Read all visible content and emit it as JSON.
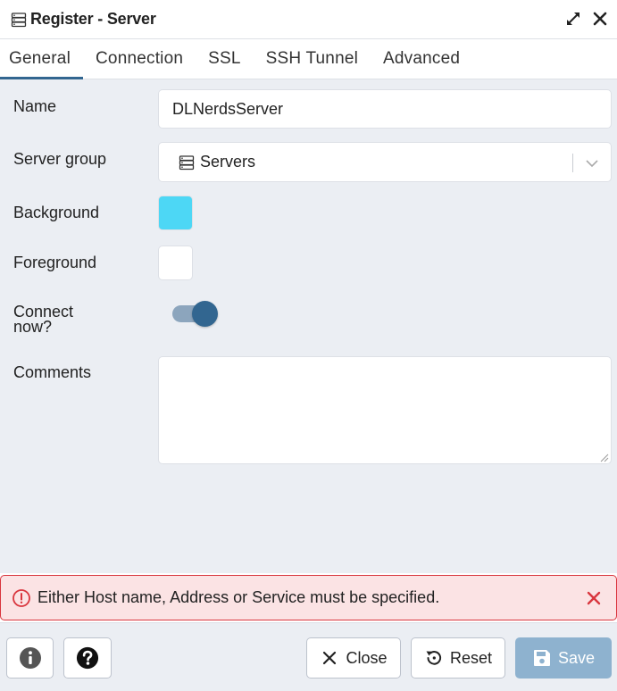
{
  "dialog": {
    "title": "Register - Server",
    "icons": {
      "title": "server-icon",
      "expand": "expand-icon",
      "close": "close-icon"
    }
  },
  "tabs": [
    {
      "label": "General",
      "active": true
    },
    {
      "label": "Connection",
      "active": false
    },
    {
      "label": "SSL",
      "active": false
    },
    {
      "label": "SSH Tunnel",
      "active": false
    },
    {
      "label": "Advanced",
      "active": false
    }
  ],
  "form": {
    "name": {
      "label": "Name",
      "value": "DLNerdsServer"
    },
    "server_group": {
      "label": "Server group",
      "value": "Servers",
      "icon": "server-icon"
    },
    "background": {
      "label": "Background",
      "color": "#4dd7f5"
    },
    "foreground": {
      "label": "Foreground",
      "color": "#ffffff"
    },
    "connect_now": {
      "label_line1": "Connect",
      "label_line2": "now?",
      "checked": true
    },
    "comments": {
      "label": "Comments",
      "value": ""
    }
  },
  "error": {
    "message": "Either Host name, Address or Service must be specified.",
    "icon": "alert-circle-icon",
    "color": "#d9363e"
  },
  "footer": {
    "info_icon": "info-icon",
    "help_icon": "help-icon",
    "close_label": "Close",
    "reset_label": "Reset",
    "save_label": "Save"
  },
  "colors": {
    "accent": "#326690",
    "save_disabled": "#8eb2cf",
    "panel_bg": "#ebeef3"
  }
}
